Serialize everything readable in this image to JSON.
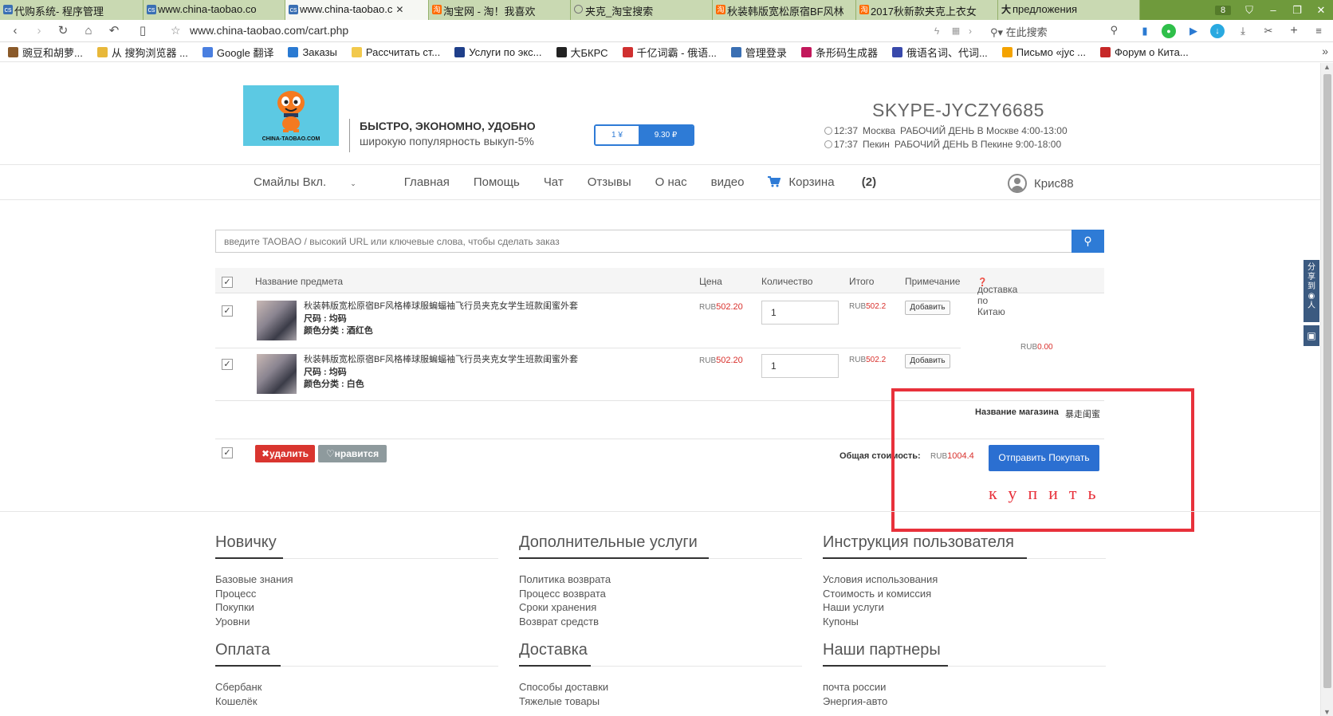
{
  "browser": {
    "tabs": [
      {
        "title": "代购系统- 程序管理",
        "icon": "cs-icon",
        "active": false
      },
      {
        "title": "www.china-taobao.co",
        "icon": "cs-icon",
        "active": false
      },
      {
        "title": "www.china-taobao.c",
        "icon": "cs-icon",
        "active": true
      },
      {
        "title": "淘宝网 - 淘！我喜欢",
        "icon": "taobao-icon",
        "active": false
      },
      {
        "title": "夹克_淘宝搜索",
        "icon": "globe-icon",
        "active": false
      },
      {
        "title": "秋装韩版宽松原宿BF风林",
        "icon": "taobao-icon",
        "active": false
      },
      {
        "title": "2017秋新款夹克上衣女",
        "icon": "taobao-icon",
        "active": false
      },
      {
        "title": "предложения",
        "icon": "dictionary-icon",
        "active": false
      }
    ],
    "tab_count": "8",
    "url": "www.china-taobao.com/cart.php",
    "search_placeholder": "在此搜索",
    "bookmarks": [
      {
        "label": "豌豆和胡萝...",
        "color": "#8a5a2a"
      },
      {
        "label": "从 搜狗浏览器 ...",
        "color": "#e8b83a"
      },
      {
        "label": "Google 翻译",
        "color": "#4a7fe0"
      },
      {
        "label": "Заказы",
        "color": "#2a7ad2"
      },
      {
        "label": "Рассчитать ст...",
        "color": "#f2c94c"
      },
      {
        "label": "Услуги по экс...",
        "color": "#1f3f8a"
      },
      {
        "label": "大БКРС",
        "color": "#222222"
      },
      {
        "label": "千亿词霸 - 俄语...",
        "color": "#d03030"
      },
      {
        "label": "管理登录",
        "color": "#3a6fb3"
      },
      {
        "label": "条形码生成器",
        "color": "#c2185b"
      },
      {
        "label": "俄语名词、代词...",
        "color": "#3949ab"
      },
      {
        "label": "Письмо «jyc ...",
        "color": "#f4a300"
      },
      {
        "label": "Форум о Кита...",
        "color": "#c62828"
      }
    ]
  },
  "header": {
    "logo_text": "CHINA-TAOBAO.COM",
    "slogan_bold": "БЫСТРО, ЭКОНОМНО, УДОБНО",
    "slogan_sub": "широкую популярность выкуп-5%",
    "rate_left": "1 ¥",
    "rate_right": "9.30 ₽",
    "skype": "SKYPE-JYCZY6685",
    "time_moscow": "12:37",
    "city_moscow": "Москва",
    "hours_moscow": "РАБОЧИЙ ДЕНЬ В Москве 4:00-13:00",
    "time_beijing": "17:37",
    "city_beijing": "Пекин",
    "hours_beijing": "РАБОЧИЙ ДЕНЬ В Пекине 9:00-18:00"
  },
  "nav": {
    "items": [
      "Смайлы Вкл.",
      "Главная",
      "Помощь",
      "Чат",
      "Отзывы",
      "О нас",
      "видео"
    ],
    "cart_label": "Корзина",
    "cart_count": "(2)",
    "username": "Крис88"
  },
  "search": {
    "placeholder": "введите TAOBAO / высокий URL или ключевые слова, чтобы сделать заказ"
  },
  "cart": {
    "columns": [
      "Название предмета",
      "Цена",
      "Количество",
      "Итого",
      "Примечание",
      "доставка по Китаю"
    ],
    "currency": "RUB",
    "items": [
      {
        "title": "秋装韩版宽松原宿BF风格棒球服蝙蝠袖飞行员夹克女学生班款闺蜜外套",
        "size": "尺码 : 均码",
        "color": "颜色分类 : 酒红色",
        "price": "502.20",
        "qty": "1",
        "total": "502.2",
        "note_btn": "Добавить"
      },
      {
        "title": "秋装韩版宽松原宿BF风格棒球服蝙蝠袖飞行员夹克女学生班款闺蜜外套",
        "size": "尺码 : 均码",
        "color": "颜色分类 : 白色",
        "price": "502.20",
        "qty": "1",
        "total": "502.2",
        "note_btn": "Добавить"
      }
    ],
    "shipping": "0.00",
    "shop_label": "Название магазина",
    "shop_name": "暴走闺蜜",
    "delete_btn": "✖удалить",
    "like_btn": "♡нравится",
    "total_label": "Общая стоимость:",
    "total_value": "1004.4",
    "submit_btn": "Отправить Покупать",
    "annotation": "купить",
    "annotation_color": "#e8313b"
  },
  "footer": {
    "columns": [
      {
        "title": "Новичку",
        "links": [
          "Базовые знания",
          "Процесс",
          "Покупки",
          "Уровни"
        ]
      },
      {
        "title": "Дополнительные услуги",
        "links": [
          "Политика возврата",
          "Процесс возврата",
          "Сроки хранения",
          "Возврат средств"
        ]
      },
      {
        "title": "Инструкция пользователя",
        "links": [
          "Условия использования",
          "Стоимость и комиссия",
          "Наши услуги",
          "Купоны"
        ]
      },
      {
        "title": "Оплата",
        "links": [
          "Сбербанк",
          "Кошелёк"
        ]
      },
      {
        "title": "Доставка",
        "links": [
          "Способы доставки",
          "Тяжелые товары"
        ]
      },
      {
        "title": "Наши партнеры",
        "links": [
          "почта россии",
          "Энергия-авто"
        ]
      }
    ]
  },
  "colors": {
    "brand_blue": "#2e7bd6",
    "price_red": "#d9302c",
    "delete_red": "#d9352f",
    "tabbar_green": "#6f9a3c"
  }
}
